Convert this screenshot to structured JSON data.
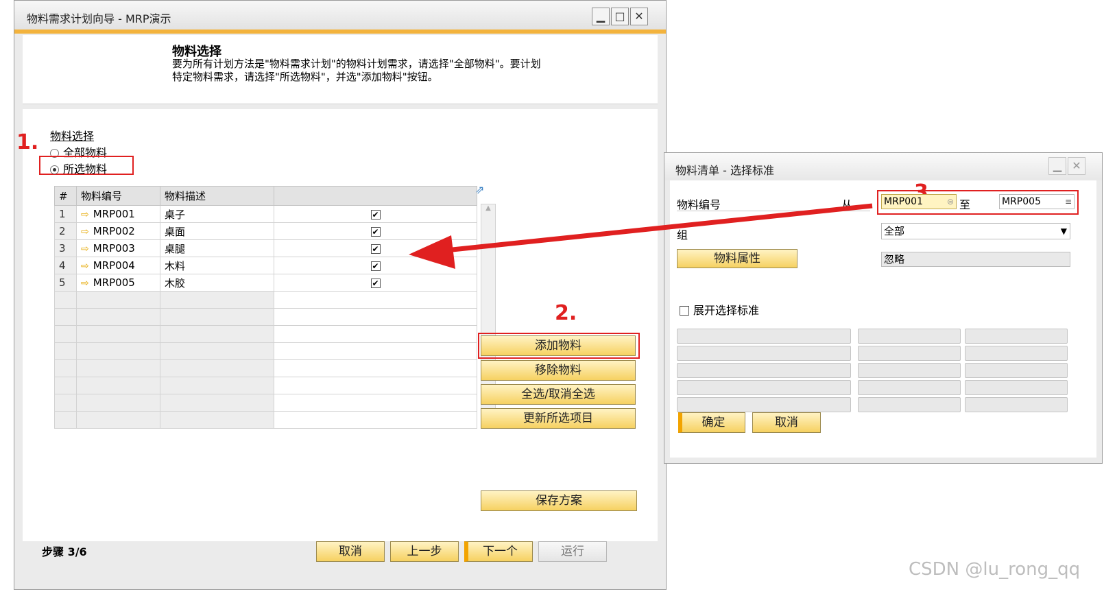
{
  "main_window": {
    "title": "物料需求计划向导 - MRP演示",
    "header_title": "物料选择",
    "header_desc_line1": "要为所有计划方法是\"物料需求计划\"的物料计划需求，请选择\"全部物料\"。要计划",
    "header_desc_line2": "特定物料需求，请选择\"所选物料\"，并选\"添加物料\"按钮。",
    "group_label": "物料选择",
    "radio_all": "全部物料",
    "radio_selected": "所选物料",
    "columns": [
      "#",
      "物料编号",
      "物料描述"
    ],
    "rows": [
      {
        "num": "1",
        "code": "MRP001",
        "desc": "桌子"
      },
      {
        "num": "2",
        "code": "MRP002",
        "desc": "桌面"
      },
      {
        "num": "3",
        "code": "MRP003",
        "desc": "桌腿"
      },
      {
        "num": "4",
        "code": "MRP004",
        "desc": "木料"
      },
      {
        "num": "5",
        "code": "MRP005",
        "desc": "木胶"
      }
    ],
    "buttons": {
      "add": "添加物料",
      "remove": "移除物料",
      "select_all": "全选/取消全选",
      "refresh": "更新所选项目",
      "save": "保存方案",
      "cancel": "取消",
      "prev": "上一步",
      "next": "下一个",
      "run": "运行"
    },
    "step": "步骤 3/6"
  },
  "annotations": {
    "mark1": "1.",
    "mark2": "2.",
    "mark3": "3."
  },
  "dialog": {
    "title": "物料清单 - 选择标准",
    "item_code_label": "物料编号",
    "from_label": "从",
    "from_value": "MRP001",
    "to_label": "至",
    "to_value": "MRP005",
    "group_label": "组",
    "group_value": "全部",
    "properties_button": "物料属性",
    "properties_value": "忽略",
    "expand_label": "展开选择标准",
    "ok_button": "确定",
    "cancel_button": "取消"
  },
  "watermark": "CSDN @lu_rong_qq",
  "colors": {
    "accent": "#f3b33d",
    "button_yellow": "#f6d161",
    "annotation_red": "#e02020"
  }
}
